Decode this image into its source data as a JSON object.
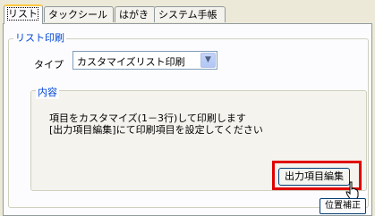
{
  "tabs": [
    {
      "label": "リスト",
      "active": true
    },
    {
      "label": "タックシール",
      "active": false
    },
    {
      "label": "はがき",
      "active": false
    },
    {
      "label": "システム手帳",
      "active": false
    }
  ],
  "list_print": {
    "group_title": "リスト印刷",
    "type_label": "タイプ",
    "type_value": "カスタマイズリスト印刷",
    "content": {
      "group_title": "内容",
      "line1": "項目をカスタマイズ(1－3行)して印刷します",
      "line2": "[出力項目編集]にて印刷項目を設定してください",
      "output_button": "出力項目編集"
    }
  },
  "position_button": "位置補正",
  "colors": {
    "highlight": "#e00000",
    "group_title": "#0046d5",
    "active_tab_top": "#ffc83c"
  }
}
